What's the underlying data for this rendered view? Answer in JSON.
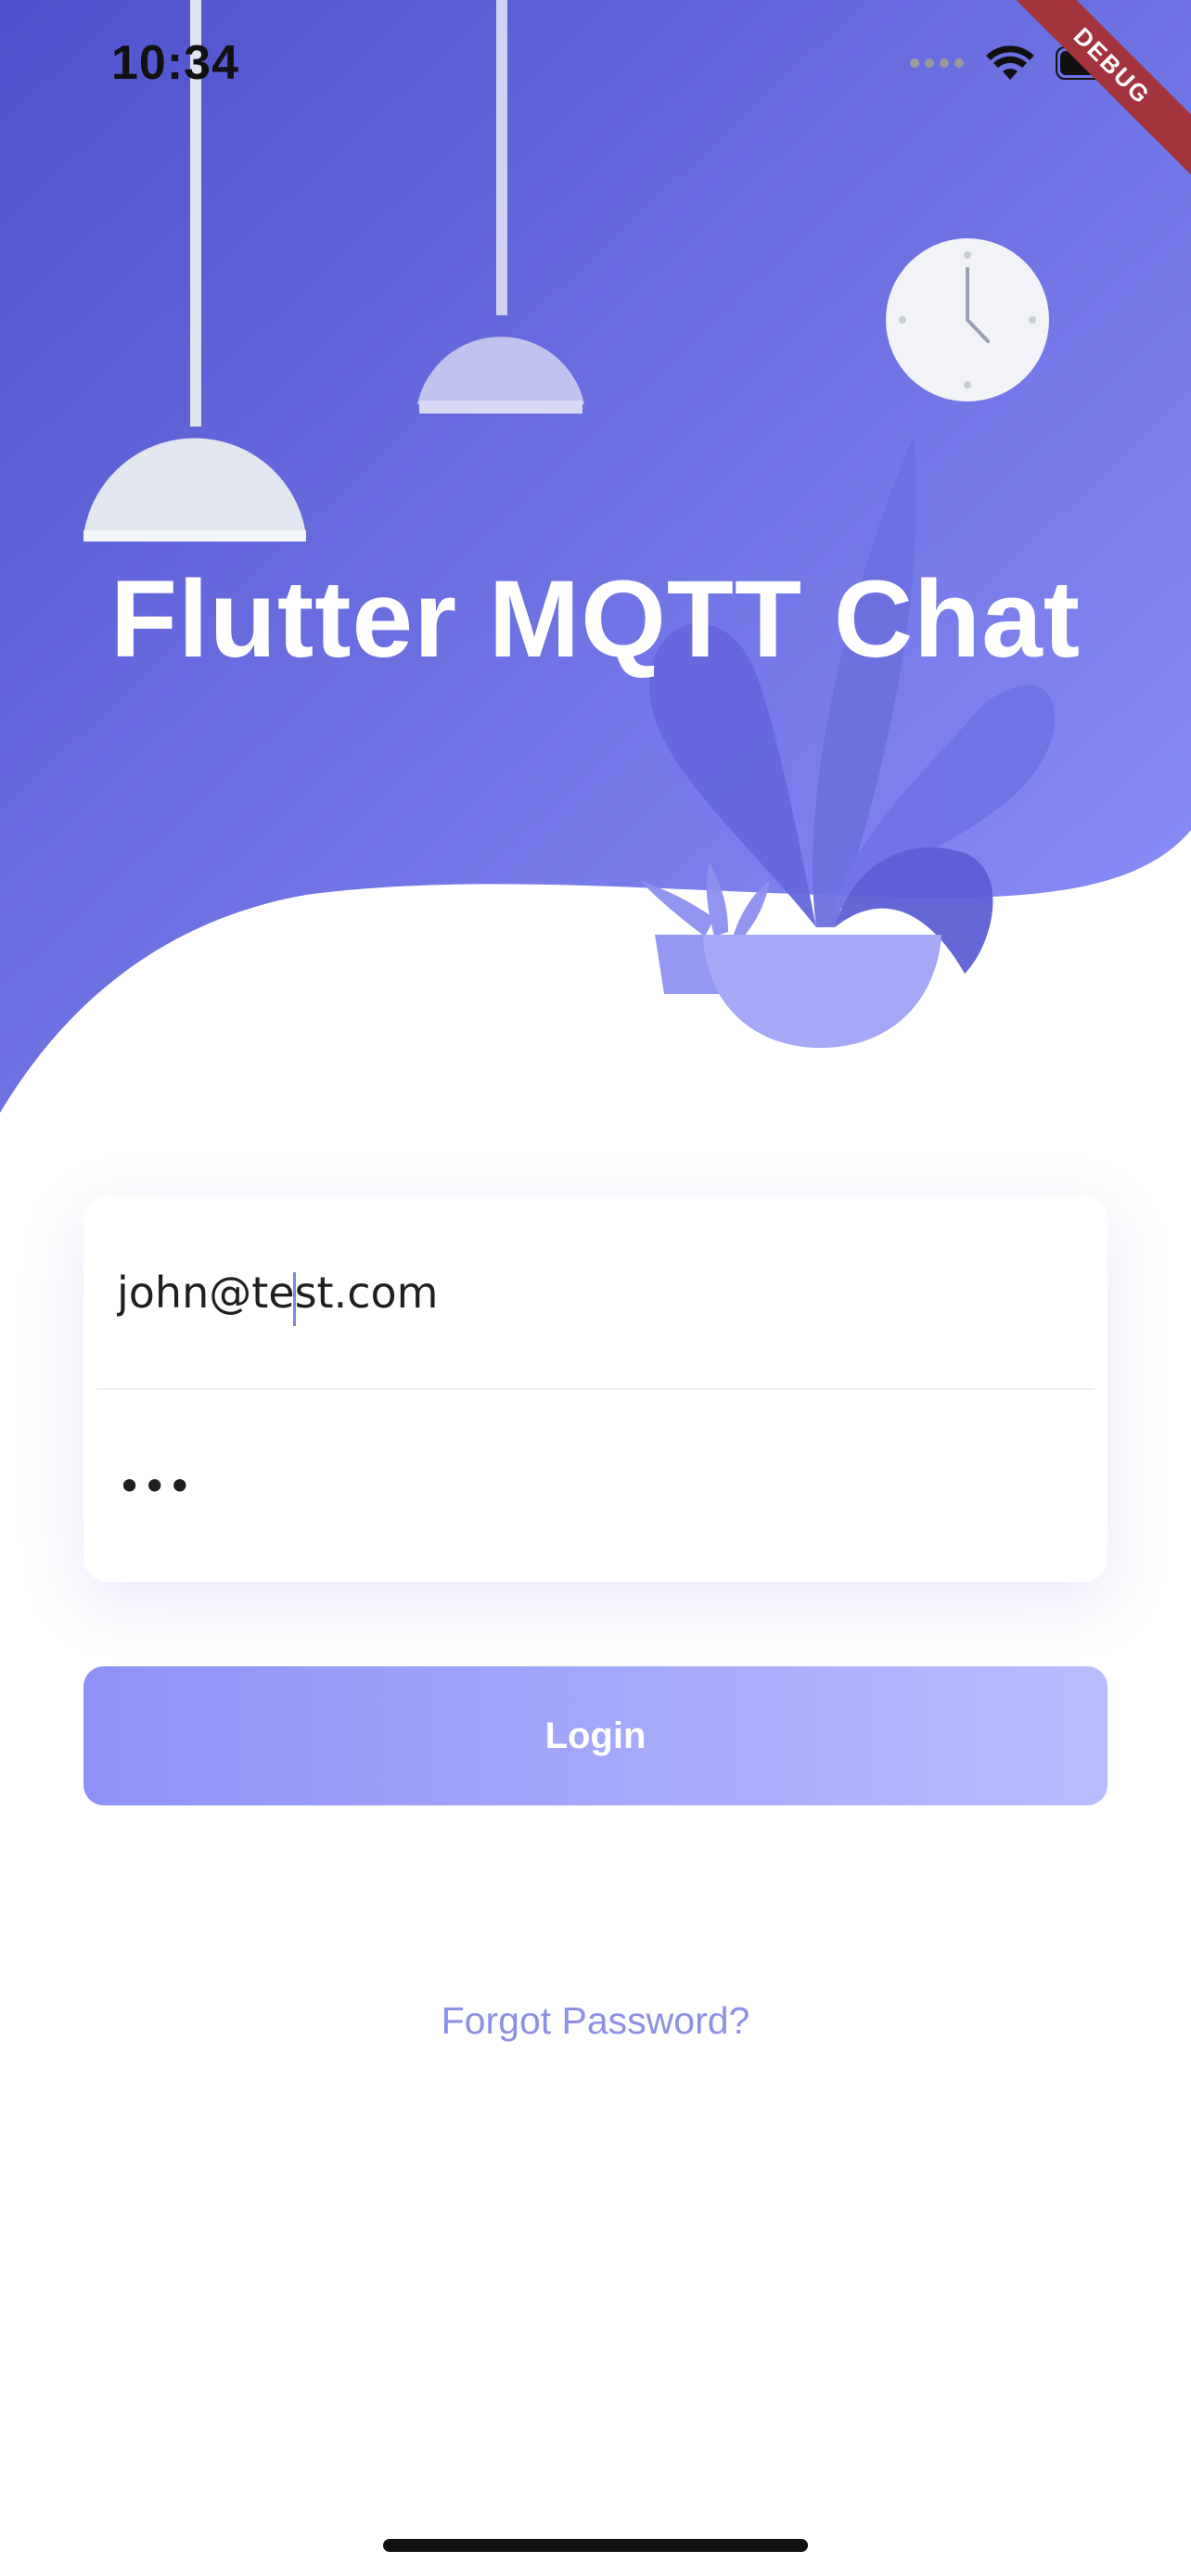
{
  "status_bar": {
    "time": "10:34",
    "signal_icon": "cellular-signal-icon",
    "wifi_icon": "wifi-icon",
    "battery_icon": "battery-icon"
  },
  "debug_banner": "DEBUG",
  "app": {
    "title": "Flutter MQTT Chat"
  },
  "login_form": {
    "email_value": "john@test.com",
    "password_value": "•••",
    "login_label": "Login",
    "forgot_label": "Forgot Password?"
  },
  "theme": {
    "gradient_start": "#4e52cc",
    "gradient_end": "#8a8ff8",
    "button_start": "#8e92f7",
    "button_end": "#b9bdfd",
    "link_color": "#8c91e6"
  }
}
